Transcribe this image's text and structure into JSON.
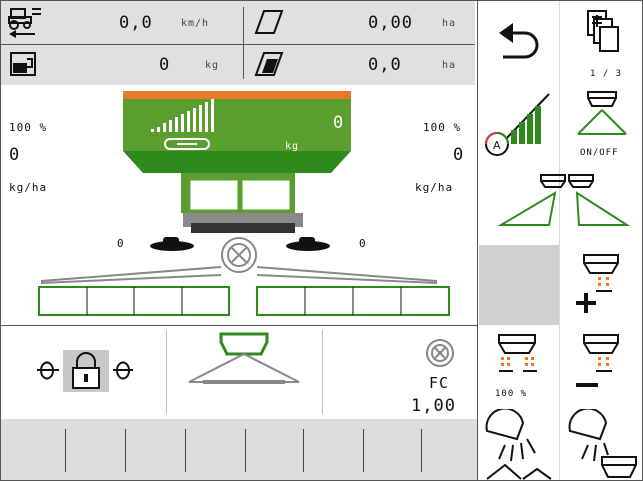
{
  "status": {
    "speed_value": "0,0",
    "speed_unit": "km/h",
    "area_value": "0,00",
    "area_unit": "ha",
    "fill_value": "0",
    "fill_unit": "kg",
    "area2_value": "0,0",
    "area2_unit": "ha"
  },
  "spreader": {
    "left_rate_percent": "100 %",
    "right_rate_percent": "100 %",
    "left_rate_value": "0",
    "right_rate_value": "0",
    "left_rate_unit": "kg/ha",
    "right_rate_unit": "kg/ha",
    "hopper_value": "0",
    "hopper_unit": "kg",
    "left_disc_value": "0",
    "right_disc_value": "0"
  },
  "bottom_panel": {
    "fc_label": "FC",
    "fc_value": "1,00"
  },
  "softkeys": {
    "page_indicator": "1 / 3",
    "on_off_label": "ON/OFF",
    "rate_percent_label": "100 %"
  },
  "colors": {
    "machine_green": "#5a9e2f",
    "dark_green": "#2f8a1e",
    "orange": "#e87a2a",
    "panel_gray": "#e0e0e0"
  }
}
